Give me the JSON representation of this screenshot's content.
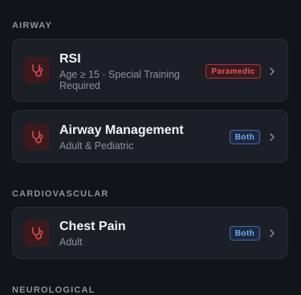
{
  "sections": [
    {
      "title": "AIRWAY",
      "cards": [
        {
          "title": "RSI",
          "subtitle": "Age ≥ 15 · Special Training Required",
          "badge": "Paramedic",
          "badge_color": "#e2585a"
        },
        {
          "title": "Airway Management",
          "subtitle": "Adult & Pediatric",
          "badge": "Both",
          "badge_color": "#78a9ec"
        }
      ]
    },
    {
      "title": "CARDIOVASCULAR",
      "cards": [
        {
          "title": "Chest Pain",
          "subtitle": "Adult",
          "badge": "Both",
          "badge_color": "#78a9ec"
        }
      ]
    },
    {
      "title": "NEUROLOGICAL",
      "cards": []
    }
  ],
  "icons": {
    "card_icon": "stethoscope-icon",
    "chevron": "chevron-right-icon"
  },
  "colors": {
    "background": "#111418",
    "card": "#1c2026",
    "icon_bg": "#3a1a1f",
    "icon": "#d94a4f"
  }
}
